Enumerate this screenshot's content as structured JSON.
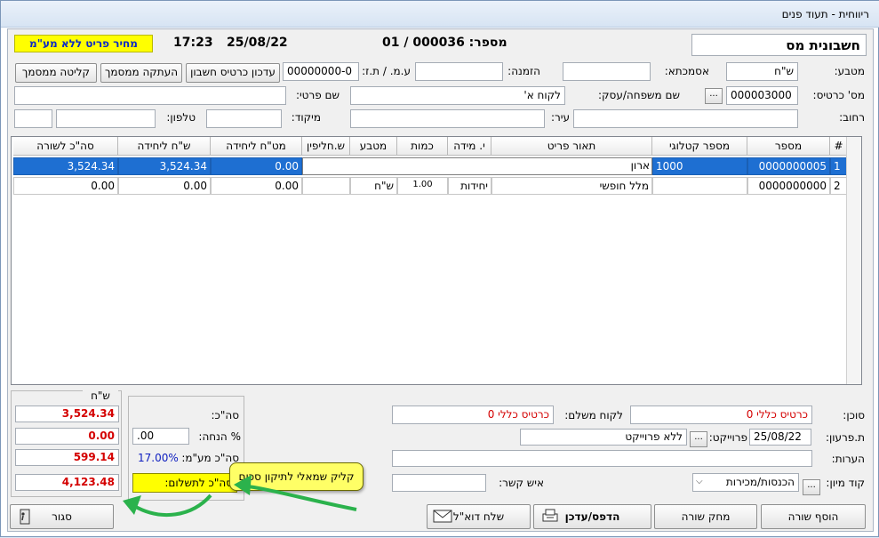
{
  "window": {
    "title": "ריווחית - תעוד פנים"
  },
  "header": {
    "doc_type": "חשבונית מס",
    "doc_number": "מספר: 000036 / 01",
    "date": "25/08/22",
    "time": "17:23",
    "price_mode": "מחיר פריט ללא מע\"מ"
  },
  "form": {
    "currency_label": "מטבע:",
    "currency_value": "ש\"ח",
    "warehouse_label": "אסמכתא:",
    "warehouse_value": "",
    "order_label": "הזמנה:",
    "order_value": "",
    "vat_id_label": "ע.מ. / ת.ז:",
    "vat_id_value": "00000000-0",
    "update_card_btn": "עדכון כרטיס חשבון",
    "copy_doc_btn": "העתקה ממסמך",
    "import_doc_btn": "קליטה ממסמך",
    "card_no_label": "מס' כרטיס:",
    "card_no_value": "000003000",
    "ellipsis": "...",
    "name_label": "שם משפחה/עסק:",
    "name_value": "לקוח א'",
    "first_name_label": "שם פרטי:",
    "first_name_value": "",
    "street_label": "רחוב:",
    "street_value": "",
    "city_label": "עיר:",
    "city_value": "",
    "zip_label": "מיקוד:",
    "zip_value": "",
    "phone_label": "טלפון:",
    "phone_value": ""
  },
  "grid": {
    "columns": [
      "#",
      "מספר",
      "מספר קטלוגי",
      "תאור פריט",
      "י. מידה",
      "כמות",
      "מטבע",
      "ש.חליפין",
      "מט\"ח ליחידה",
      "ש\"ח ליחידה",
      "סה\"כ לשורה"
    ],
    "rows": [
      {
        "idx": "1",
        "number": "0000000005",
        "catalog": "1000",
        "desc": "ארון",
        "unit": "",
        "qty": "",
        "currency": "",
        "rate": "",
        "fx_unit": "0.00",
        "ils_unit": "3,524.34",
        "line_total": "3,524.34"
      },
      {
        "idx": "2",
        "number": "0000000000",
        "catalog": "",
        "desc": "מלל חופשי",
        "unit": "יחידות",
        "qty": "1.00",
        "currency": "ש\"ח",
        "rate": "",
        "fx_unit": "0.00",
        "ils_unit": "0.00",
        "line_total": "0.00"
      }
    ]
  },
  "totals": {
    "currency_header": "ש\"ח",
    "subtotal_label": "סה\"כ:",
    "subtotal": "3,524.34",
    "discount_label": "% הנחה:",
    "discount_pct": ".00",
    "discount_value": "0.00",
    "vat_label": "סה\"כ מע\"מ:",
    "vat_pct": "17.00%",
    "vat_value": "599.14",
    "pay_label": "סה\"כ לתשלום:",
    "pay_value": "4,123.48"
  },
  "callout": {
    "text": "קליק שמאלי לתיקון סכום"
  },
  "footer": {
    "agent_label": "סוכן:",
    "agent_value": "כרטיס כללי 0",
    "payer_label": "לקוח משלם:",
    "payer_value": "כרטיס כללי 0",
    "due_label": "ת.פרעון:",
    "due_value": "25/08/22",
    "project_label": "פרוייקט:",
    "project_value": "ללא פרוייקט",
    "notes_label": "הערות:",
    "notes_value": "",
    "sort_label": "קוד מיון:",
    "sort_value": "הכנסות/מכירות",
    "contact_label": "איש קשר:",
    "contact_value": ""
  },
  "buttons": {
    "add_row": "הוסף שורה",
    "delete_row": "מחק שורה",
    "print_update": "הדפס/עדכן",
    "send_email": "שלח דוא\"ל",
    "close": "סגור"
  },
  "colors": {
    "selected_row": "#1e6fd2",
    "highlight": "#ffff00",
    "total_red": "#d40000",
    "callout": "#ffff66",
    "arrow": "#2bb24c"
  }
}
